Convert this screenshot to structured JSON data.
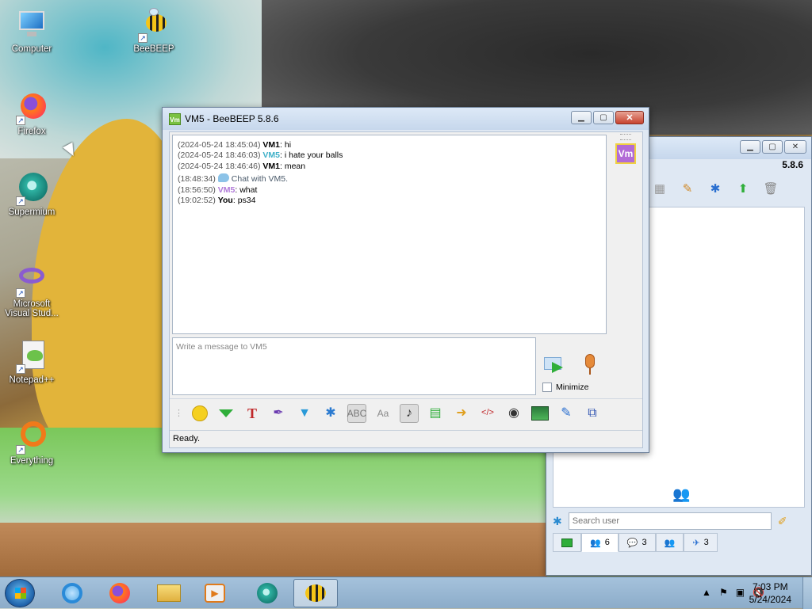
{
  "desktop": {
    "icons": [
      {
        "label": "Computer",
        "icon": "computer-icon"
      },
      {
        "label": "BeeBEEP",
        "icon": "beebeep-icon"
      },
      {
        "label": "Firefox",
        "icon": "firefox-icon"
      },
      {
        "label": "Supermium",
        "icon": "supermium-icon"
      },
      {
        "label": "Microsoft Visual Stud...",
        "icon": "visual-studio-icon"
      },
      {
        "label": "Notepad++",
        "icon": "notepadpp-icon"
      },
      {
        "label": "Everything",
        "icon": "everything-icon"
      }
    ]
  },
  "chat_window": {
    "title": "VM5 - BeeBEEP 5.8.6",
    "badge": "Vm",
    "avatar": "Vm",
    "history": [
      {
        "ts": "(2024-05-24 18:45:04)",
        "user": "VM1",
        "text": ": hi",
        "style": "u-vm1"
      },
      {
        "ts": "(2024-05-24 18:46:03)",
        "user": "VM5",
        "text": ": i hate your balls",
        "style": "u-vm5a"
      },
      {
        "ts": "(2024-05-24 18:46:46)",
        "user": "VM1",
        "text": ": mean",
        "style": "u-vm1"
      },
      {
        "ts": "(18:48:34)",
        "user": "",
        "text": "Chat with VM5.",
        "style": "sys"
      },
      {
        "ts": "(18:56:50)",
        "user": "VM5",
        "text": ": what",
        "style": "u-vm5b"
      },
      {
        "ts": "(19:02:52)",
        "user": "You",
        "text": ": ps34",
        "style": "u-you"
      }
    ],
    "compose_placeholder": "Write a message to VM5",
    "minimize_label": "Minimize",
    "status": "Ready.",
    "toolbar": [
      "emoji-icon",
      "green-down-arrow-icon",
      "font-icon",
      "color-pick-icon",
      "filter-icon",
      "settings-gear-icon",
      "spellcheck-icon",
      "text-format-icon",
      "note-icon",
      "save-chat-icon",
      "forward-icon",
      "html-icon",
      "screenshot-icon",
      "image-icon",
      "edit-icon",
      "share-icon"
    ]
  },
  "main_window": {
    "version": "5.8.6",
    "search_placeholder": "Search user",
    "tabs": [
      {
        "icon": "online-icon",
        "count": ""
      },
      {
        "icon": "users-icon",
        "count": "6"
      },
      {
        "icon": "chats-icon",
        "count": "3"
      },
      {
        "icon": "groups-icon",
        "count": ""
      },
      {
        "icon": "shares-icon",
        "count": "3"
      }
    ]
  },
  "taskbar": {
    "time": "7:03 PM",
    "date": "5/24/2024"
  },
  "colors": {
    "vm5_user": "#3fb0c8",
    "vm5_user_alt": "#b07ad8",
    "avatar_bg": "#b26bd6"
  }
}
